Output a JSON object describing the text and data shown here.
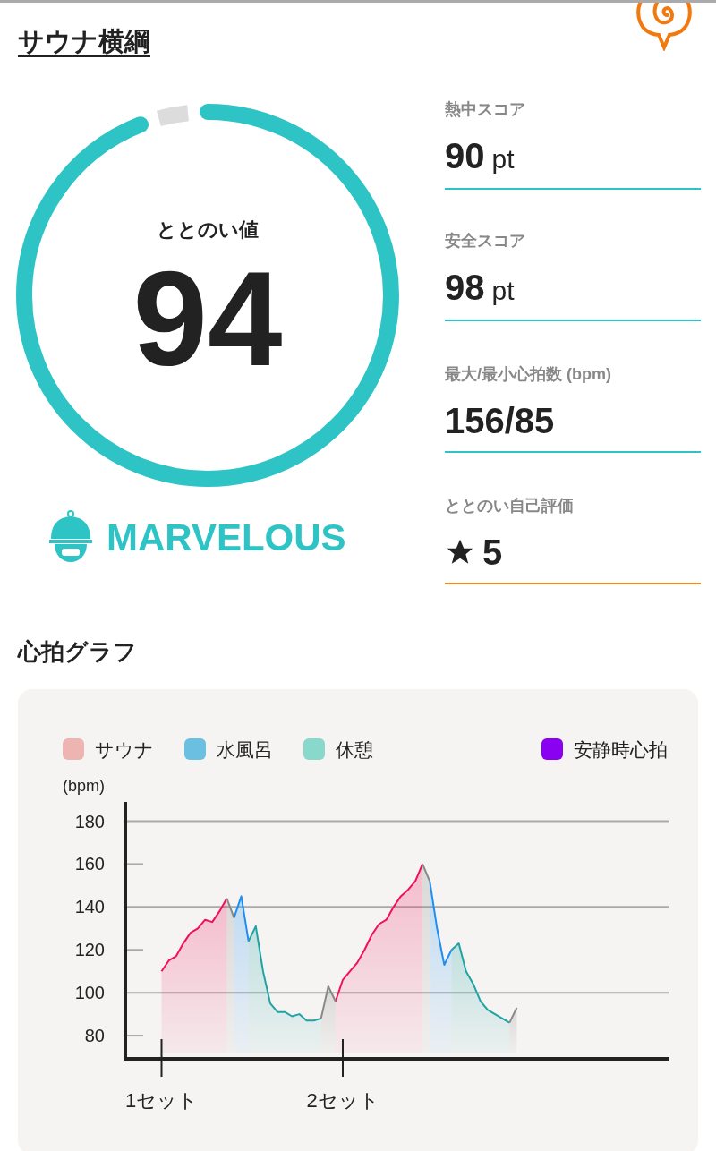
{
  "title": "サウナ横綱",
  "gauge": {
    "label": "ととのい値",
    "value": "94",
    "level": 0.94
  },
  "rank": "MARVELOUS",
  "scores": [
    {
      "kind": "score",
      "label": "熱中スコア",
      "value": "90",
      "unit": "pt"
    },
    {
      "kind": "score",
      "label": "安全スコア",
      "value": "98",
      "unit": "pt"
    },
    {
      "kind": "score",
      "label": "最大/最小心拍数 (bpm)",
      "value": "156/85"
    },
    {
      "kind": "rating",
      "label": "ととのい自己評価",
      "value": "5"
    }
  ],
  "graph": {
    "heading": "心拍グラフ",
    "legend": [
      {
        "label": "サウナ",
        "color": "#eeb4b2"
      },
      {
        "label": "水風呂",
        "color": "#6bbfe0"
      },
      {
        "label": "休憩",
        "color": "#88d8cc"
      },
      {
        "label": "安静時心拍",
        "color": "#8a00f0"
      }
    ],
    "chart_data": {
      "type": "line",
      "ylabel": "(bpm)",
      "ylim": [
        70,
        189
      ],
      "grid": true,
      "categories": [
        "1セット",
        null,
        null,
        null,
        null,
        null,
        null,
        null,
        null,
        null,
        null,
        null,
        null,
        null,
        null,
        null,
        null,
        null,
        null,
        null,
        null,
        null,
        null,
        null,
        null,
        "2セット",
        null,
        null,
        null,
        null,
        null,
        null,
        null,
        null,
        null,
        null,
        null,
        null,
        null,
        null,
        null,
        null,
        null,
        null,
        null,
        null,
        null,
        null,
        null,
        null
      ],
      "yticks": [
        80,
        100,
        120,
        140,
        160,
        180
      ],
      "series": [
        {
          "color": "#f2105a",
          "values": [
            110,
            115,
            117,
            123,
            128,
            130,
            134,
            133,
            138,
            144,
            null,
            null,
            null,
            null,
            null,
            null,
            null,
            null,
            null,
            null,
            null,
            null,
            null,
            null,
            96,
            106,
            110,
            114,
            120,
            127,
            132,
            134,
            140,
            145,
            148,
            152,
            160,
            null,
            null,
            null,
            null,
            null,
            null,
            null,
            null,
            null,
            null,
            null,
            null,
            null
          ]
        },
        {
          "color": "#1e8ff0",
          "values": [
            null,
            null,
            null,
            null,
            null,
            null,
            null,
            null,
            null,
            null,
            135,
            145,
            124,
            null,
            null,
            null,
            null,
            null,
            null,
            null,
            null,
            null,
            null,
            null,
            null,
            null,
            null,
            null,
            null,
            null,
            null,
            null,
            null,
            null,
            null,
            null,
            null,
            152,
            130,
            113,
            120,
            null,
            null,
            null,
            null,
            null,
            null,
            null,
            null,
            null
          ]
        },
        {
          "color": "#1fa3a3",
          "values": [
            null,
            null,
            null,
            null,
            null,
            null,
            null,
            null,
            null,
            null,
            null,
            null,
            124,
            131,
            110,
            95,
            91,
            91,
            89,
            90,
            87,
            87,
            88,
            null,
            null,
            null,
            null,
            null,
            null,
            null,
            null,
            null,
            null,
            null,
            null,
            null,
            null,
            null,
            null,
            null,
            120,
            123,
            110,
            104,
            96,
            92,
            90,
            88,
            86,
            null
          ]
        },
        {
          "color": "#888888",
          "values": [
            null,
            null,
            null,
            null,
            null,
            null,
            null,
            null,
            null,
            144,
            135,
            null,
            null,
            null,
            null,
            null,
            null,
            null,
            null,
            null,
            null,
            null,
            88,
            103,
            96,
            null,
            null,
            null,
            null,
            null,
            null,
            null,
            null,
            null,
            null,
            null,
            160,
            152,
            null,
            null,
            null,
            null,
            null,
            null,
            null,
            null,
            null,
            null,
            86,
            93
          ]
        }
      ]
    }
  }
}
